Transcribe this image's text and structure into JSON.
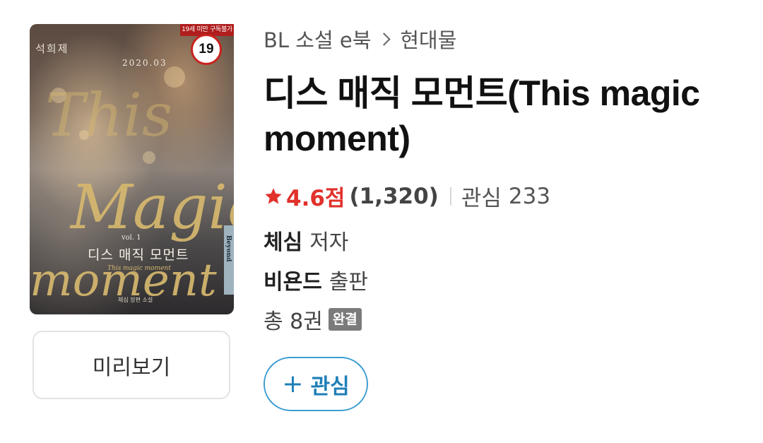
{
  "cover": {
    "age_notice": "19세 미만 구독불가",
    "age_rating": "19",
    "cover_author": "석희제",
    "cover_date": "2020.03",
    "script_this": "This",
    "script_magic": "Magic",
    "script_moment": "moment",
    "vol": "vol. 1",
    "kr_title": "디스 매직 모먼트",
    "en_sub": "This magic moment",
    "byline": "체심 장편 소설",
    "publisher_tab": "Beyond"
  },
  "preview_button": "미리보기",
  "breadcrumb": {
    "category": "BL 소설 e북",
    "subcategory": "현대물"
  },
  "title": "디스 매직 모먼트(This magic moment)",
  "rating": {
    "score": "4.6점",
    "count": "(1,320)",
    "interest_label": "관심",
    "interest_count": "233",
    "star_color": "#e1312b"
  },
  "author": {
    "name": "체심",
    "role": "저자"
  },
  "publisher": {
    "name": "비욘드",
    "role": "출판"
  },
  "volumes": {
    "text": "총 8권",
    "badge": "완결"
  },
  "interest_button": {
    "plus": "+",
    "label": "관심"
  },
  "colors": {
    "accent": "#1d7fb8",
    "age_red": "#c8231f"
  }
}
